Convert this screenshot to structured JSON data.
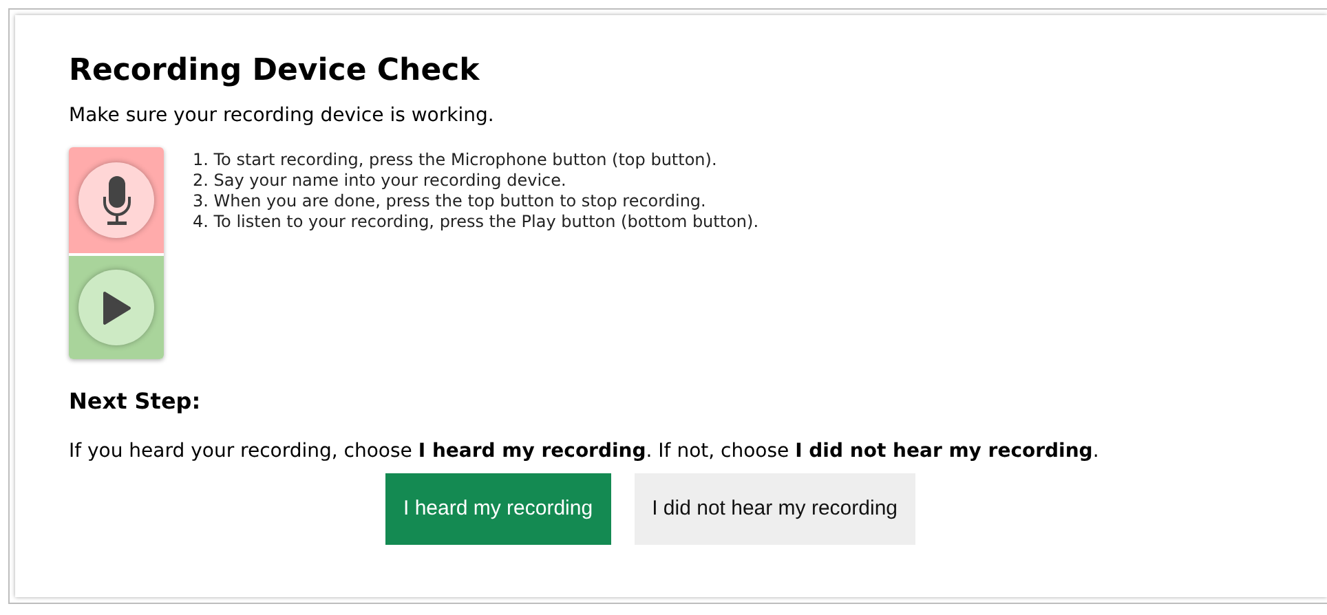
{
  "title": "Recording Device Check",
  "subtitle": "Make sure your recording device is working.",
  "device_buttons": [
    {
      "kind": "record"
    },
    {
      "kind": "play"
    }
  ],
  "steps": [
    "1. To start recording, press the Microphone button (top button).",
    "2. Say your name into your recording device.",
    "3. When you are done, press the top button to stop recording.",
    "4. To listen to your recording, press the Play button (bottom button)."
  ],
  "next_step": {
    "heading": "Next Step:",
    "instruction": "If you heard your recording, choose **I heard my recording**. If not, choose **I did not hear my recording**."
  },
  "buttons": [
    {
      "label": "I heard my recording",
      "kind": "primary"
    },
    {
      "label": "I did not hear my recording",
      "kind": "secondary"
    }
  ]
}
